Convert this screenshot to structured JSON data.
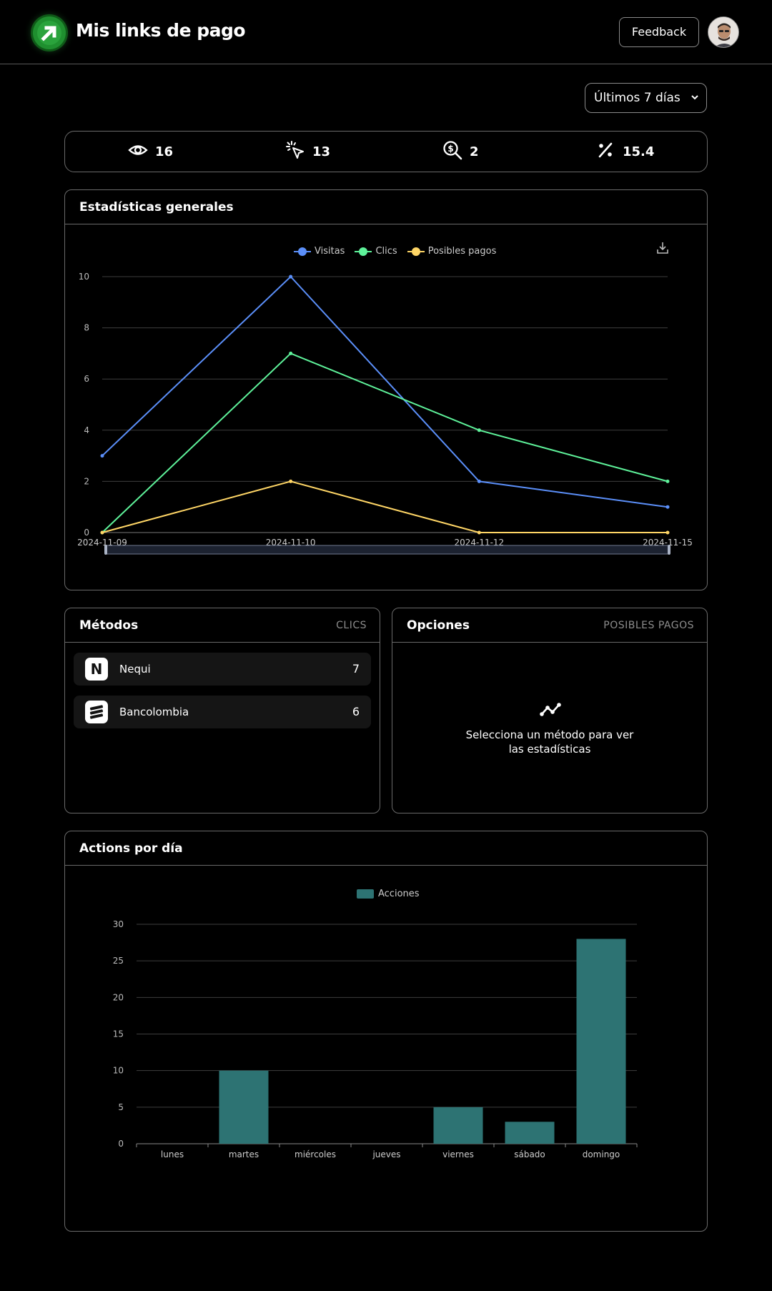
{
  "header": {
    "title": "Mis links de pago",
    "feedback_label": "Feedback"
  },
  "filter": {
    "range_label": "Últimos 7 días"
  },
  "stats": [
    {
      "icon": "eye-icon",
      "value": "16"
    },
    {
      "icon": "pointer-click-icon",
      "value": "13"
    },
    {
      "icon": "dollar-search-icon",
      "value": "2"
    },
    {
      "icon": "percent-icon",
      "value": "15.4"
    }
  ],
  "general": {
    "title": "Estadísticas generales",
    "download_icon": "download-icon",
    "chart_data": {
      "type": "line",
      "x": [
        "2024-11-09",
        "2024-11-10",
        "2024-11-12",
        "2024-11-15"
      ],
      "ylim": [
        0,
        10
      ],
      "yticks": [
        0,
        2,
        4,
        6,
        8,
        10
      ],
      "grid": true,
      "legend": "top-center",
      "series": [
        {
          "name": "Visitas",
          "color": "#5b8ff9",
          "values": [
            3,
            10,
            2,
            1
          ]
        },
        {
          "name": "Clics",
          "color": "#5ef29a",
          "values": [
            0,
            7,
            4,
            2
          ]
        },
        {
          "name": "Posibles pagos",
          "color": "#ffd666",
          "values": [
            0,
            2,
            0,
            0
          ]
        }
      ]
    }
  },
  "methods": {
    "title": "Métodos",
    "subtitle": "CLICS",
    "items": [
      {
        "logo": "N",
        "name": "Nequi",
        "value": "7"
      },
      {
        "logo": "",
        "name": "Bancolombia",
        "value": "6"
      }
    ]
  },
  "options": {
    "title": "Opciones",
    "subtitle": "POSIBLES PAGOS",
    "empty_icon": "trend-line-icon",
    "empty_text": "Selecciona un método para ver las estadísticas"
  },
  "daily": {
    "title": "Actions por día",
    "chart_data": {
      "type": "bar",
      "categories": [
        "lunes",
        "martes",
        "miércoles",
        "jueves",
        "viernes",
        "sábado",
        "domingo"
      ],
      "series": [
        {
          "name": "Acciones",
          "color": "#2d7373",
          "values": [
            0,
            10,
            0,
            0,
            5,
            3,
            28
          ]
        }
      ],
      "ylim": [
        0,
        30
      ],
      "yticks": [
        0,
        5,
        10,
        15,
        20,
        25,
        30
      ],
      "grid": true,
      "legend": "top-center"
    }
  }
}
